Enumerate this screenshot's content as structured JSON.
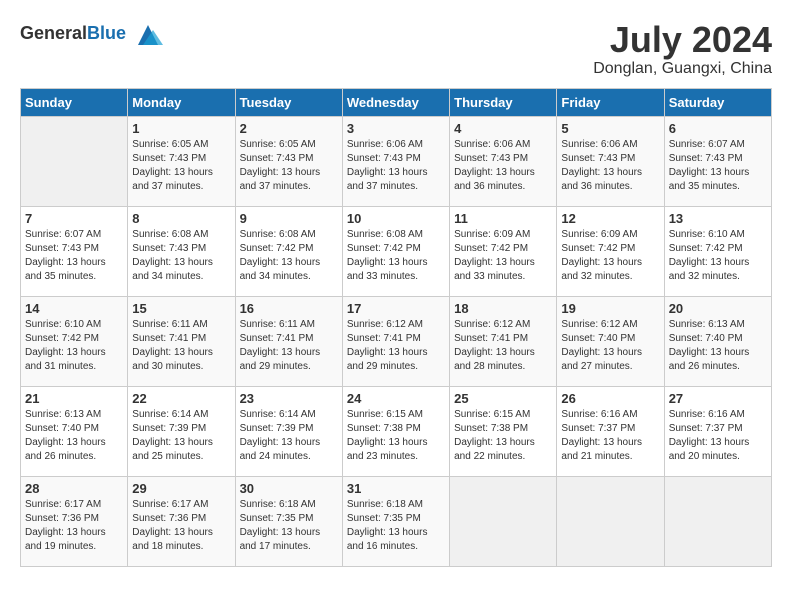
{
  "header": {
    "logo_general": "General",
    "logo_blue": "Blue",
    "month": "July 2024",
    "location": "Donglan, Guangxi, China"
  },
  "days_of_week": [
    "Sunday",
    "Monday",
    "Tuesday",
    "Wednesday",
    "Thursday",
    "Friday",
    "Saturday"
  ],
  "weeks": [
    [
      {
        "day": "",
        "sunrise": "",
        "sunset": "",
        "daylight": ""
      },
      {
        "day": "1",
        "sunrise": "Sunrise: 6:05 AM",
        "sunset": "Sunset: 7:43 PM",
        "daylight": "Daylight: 13 hours and 37 minutes."
      },
      {
        "day": "2",
        "sunrise": "Sunrise: 6:05 AM",
        "sunset": "Sunset: 7:43 PM",
        "daylight": "Daylight: 13 hours and 37 minutes."
      },
      {
        "day": "3",
        "sunrise": "Sunrise: 6:06 AM",
        "sunset": "Sunset: 7:43 PM",
        "daylight": "Daylight: 13 hours and 37 minutes."
      },
      {
        "day": "4",
        "sunrise": "Sunrise: 6:06 AM",
        "sunset": "Sunset: 7:43 PM",
        "daylight": "Daylight: 13 hours and 36 minutes."
      },
      {
        "day": "5",
        "sunrise": "Sunrise: 6:06 AM",
        "sunset": "Sunset: 7:43 PM",
        "daylight": "Daylight: 13 hours and 36 minutes."
      },
      {
        "day": "6",
        "sunrise": "Sunrise: 6:07 AM",
        "sunset": "Sunset: 7:43 PM",
        "daylight": "Daylight: 13 hours and 35 minutes."
      }
    ],
    [
      {
        "day": "7",
        "sunrise": "Sunrise: 6:07 AM",
        "sunset": "Sunset: 7:43 PM",
        "daylight": "Daylight: 13 hours and 35 minutes."
      },
      {
        "day": "8",
        "sunrise": "Sunrise: 6:08 AM",
        "sunset": "Sunset: 7:43 PM",
        "daylight": "Daylight: 13 hours and 34 minutes."
      },
      {
        "day": "9",
        "sunrise": "Sunrise: 6:08 AM",
        "sunset": "Sunset: 7:42 PM",
        "daylight": "Daylight: 13 hours and 34 minutes."
      },
      {
        "day": "10",
        "sunrise": "Sunrise: 6:08 AM",
        "sunset": "Sunset: 7:42 PM",
        "daylight": "Daylight: 13 hours and 33 minutes."
      },
      {
        "day": "11",
        "sunrise": "Sunrise: 6:09 AM",
        "sunset": "Sunset: 7:42 PM",
        "daylight": "Daylight: 13 hours and 33 minutes."
      },
      {
        "day": "12",
        "sunrise": "Sunrise: 6:09 AM",
        "sunset": "Sunset: 7:42 PM",
        "daylight": "Daylight: 13 hours and 32 minutes."
      },
      {
        "day": "13",
        "sunrise": "Sunrise: 6:10 AM",
        "sunset": "Sunset: 7:42 PM",
        "daylight": "Daylight: 13 hours and 32 minutes."
      }
    ],
    [
      {
        "day": "14",
        "sunrise": "Sunrise: 6:10 AM",
        "sunset": "Sunset: 7:42 PM",
        "daylight": "Daylight: 13 hours and 31 minutes."
      },
      {
        "day": "15",
        "sunrise": "Sunrise: 6:11 AM",
        "sunset": "Sunset: 7:41 PM",
        "daylight": "Daylight: 13 hours and 30 minutes."
      },
      {
        "day": "16",
        "sunrise": "Sunrise: 6:11 AM",
        "sunset": "Sunset: 7:41 PM",
        "daylight": "Daylight: 13 hours and 29 minutes."
      },
      {
        "day": "17",
        "sunrise": "Sunrise: 6:12 AM",
        "sunset": "Sunset: 7:41 PM",
        "daylight": "Daylight: 13 hours and 29 minutes."
      },
      {
        "day": "18",
        "sunrise": "Sunrise: 6:12 AM",
        "sunset": "Sunset: 7:41 PM",
        "daylight": "Daylight: 13 hours and 28 minutes."
      },
      {
        "day": "19",
        "sunrise": "Sunrise: 6:12 AM",
        "sunset": "Sunset: 7:40 PM",
        "daylight": "Daylight: 13 hours and 27 minutes."
      },
      {
        "day": "20",
        "sunrise": "Sunrise: 6:13 AM",
        "sunset": "Sunset: 7:40 PM",
        "daylight": "Daylight: 13 hours and 26 minutes."
      }
    ],
    [
      {
        "day": "21",
        "sunrise": "Sunrise: 6:13 AM",
        "sunset": "Sunset: 7:40 PM",
        "daylight": "Daylight: 13 hours and 26 minutes."
      },
      {
        "day": "22",
        "sunrise": "Sunrise: 6:14 AM",
        "sunset": "Sunset: 7:39 PM",
        "daylight": "Daylight: 13 hours and 25 minutes."
      },
      {
        "day": "23",
        "sunrise": "Sunrise: 6:14 AM",
        "sunset": "Sunset: 7:39 PM",
        "daylight": "Daylight: 13 hours and 24 minutes."
      },
      {
        "day": "24",
        "sunrise": "Sunrise: 6:15 AM",
        "sunset": "Sunset: 7:38 PM",
        "daylight": "Daylight: 13 hours and 23 minutes."
      },
      {
        "day": "25",
        "sunrise": "Sunrise: 6:15 AM",
        "sunset": "Sunset: 7:38 PM",
        "daylight": "Daylight: 13 hours and 22 minutes."
      },
      {
        "day": "26",
        "sunrise": "Sunrise: 6:16 AM",
        "sunset": "Sunset: 7:37 PM",
        "daylight": "Daylight: 13 hours and 21 minutes."
      },
      {
        "day": "27",
        "sunrise": "Sunrise: 6:16 AM",
        "sunset": "Sunset: 7:37 PM",
        "daylight": "Daylight: 13 hours and 20 minutes."
      }
    ],
    [
      {
        "day": "28",
        "sunrise": "Sunrise: 6:17 AM",
        "sunset": "Sunset: 7:36 PM",
        "daylight": "Daylight: 13 hours and 19 minutes."
      },
      {
        "day": "29",
        "sunrise": "Sunrise: 6:17 AM",
        "sunset": "Sunset: 7:36 PM",
        "daylight": "Daylight: 13 hours and 18 minutes."
      },
      {
        "day": "30",
        "sunrise": "Sunrise: 6:18 AM",
        "sunset": "Sunset: 7:35 PM",
        "daylight": "Daylight: 13 hours and 17 minutes."
      },
      {
        "day": "31",
        "sunrise": "Sunrise: 6:18 AM",
        "sunset": "Sunset: 7:35 PM",
        "daylight": "Daylight: 13 hours and 16 minutes."
      },
      {
        "day": "",
        "sunrise": "",
        "sunset": "",
        "daylight": ""
      },
      {
        "day": "",
        "sunrise": "",
        "sunset": "",
        "daylight": ""
      },
      {
        "day": "",
        "sunrise": "",
        "sunset": "",
        "daylight": ""
      }
    ]
  ]
}
